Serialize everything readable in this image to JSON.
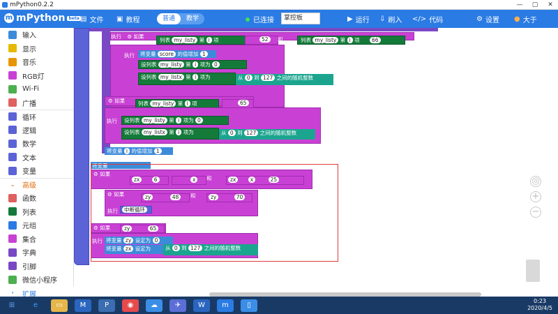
{
  "window": {
    "title": "mPython0.2.2",
    "min": "—",
    "max": "▢",
    "close": "✕"
  },
  "toolbar": {
    "logo": "mPython",
    "version": "beta",
    "file": "文件",
    "tutorial": "教程",
    "mode_normal": "普通",
    "mode_teach": "教学",
    "status": "已连接",
    "board": "掌控板",
    "run": "运行",
    "flash": "刷入",
    "code": "代码",
    "settings": "设置",
    "user": "大于"
  },
  "sidebar": {
    "items": [
      {
        "label": "输入",
        "icon": "input-icon",
        "color": "#3c8bd9"
      },
      {
        "label": "显示",
        "icon": "display-icon",
        "color": "#e6b800"
      },
      {
        "label": "音乐",
        "icon": "music-icon",
        "color": "#e69500"
      },
      {
        "label": "RGB灯",
        "icon": "rgb-icon",
        "color": "#c941d4"
      },
      {
        "label": "Wi-Fi",
        "icon": "wifi-icon",
        "color": "#4caf50"
      },
      {
        "label": "广播",
        "icon": "broadcast-icon",
        "color": "#e06060"
      },
      {
        "label": "循环",
        "icon": "loop-icon",
        "color": "#5c63d6"
      },
      {
        "label": "逻辑",
        "icon": "logic-icon",
        "color": "#5c63d6"
      },
      {
        "label": "数学",
        "icon": "math-icon",
        "color": "#5c63d6"
      },
      {
        "label": "文本",
        "icon": "text-icon",
        "color": "#5c63d6"
      },
      {
        "label": "变量",
        "icon": "variable-icon",
        "color": "#5c63d6"
      },
      {
        "label": "高级",
        "icon": "chevron-down-icon",
        "color": "#e36c0a"
      },
      {
        "label": "函数",
        "icon": "function-icon",
        "color": "#e06060"
      },
      {
        "label": "列表",
        "icon": "list-icon",
        "color": "#147a3a"
      },
      {
        "label": "元组",
        "icon": "tuple-icon",
        "color": "#2a7be4"
      },
      {
        "label": "集合",
        "icon": "set-icon",
        "color": "#c941d4"
      },
      {
        "label": "字典",
        "icon": "dict-icon",
        "color": "#7a48c4"
      },
      {
        "label": "引脚",
        "icon": "pin-icon",
        "color": "#7a48c4"
      },
      {
        "label": "微信小程序",
        "icon": "wechat-icon",
        "color": "#4caf50"
      },
      {
        "label": "扩展",
        "icon": "chevron-right-icon",
        "color": "#2a7be4"
      }
    ]
  },
  "blocks": {
    "exec": "执行",
    "if": "如果",
    "list": "列表",
    "item": "第",
    "index": "i",
    "term": "项",
    "listy": "my_listy",
    "listx": "my_listx",
    "and": "和",
    "v52": "52",
    "v66": "66",
    "add": "将变量",
    "score": "score",
    "add_to": "的值增加",
    "one": "1",
    "set_list": "设列表",
    "to": "项为",
    "zero": "0",
    "from": "从",
    "range_to": "到",
    "v127": "127",
    "rand": "之间的随机整数",
    "v65": "65",
    "var_i": "i",
    "zx": "zx",
    "zy": "zy",
    "v6": "6",
    "v25": "25",
    "v48": "48",
    "v70": "70",
    "break": "中断循环",
    "set_to": "设定为",
    "var_x": "x"
  },
  "taskbar": {
    "time": "0:23",
    "date": "2020/4/5"
  }
}
